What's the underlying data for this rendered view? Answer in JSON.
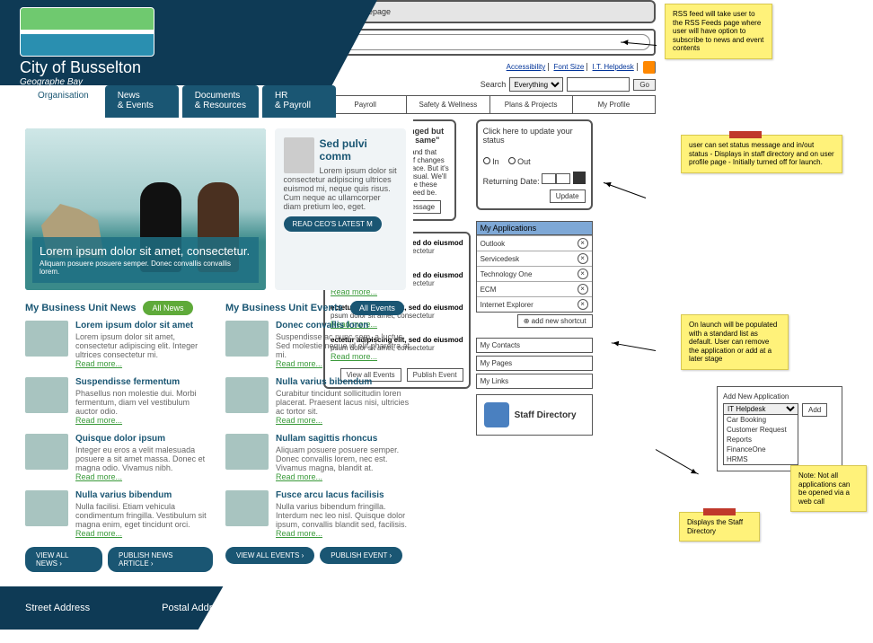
{
  "brand": {
    "title": "City of Busselton",
    "subtitle": "Geographe Bay"
  },
  "nav": {
    "tabs": [
      {
        "line1": "Organisation",
        "line2": ""
      },
      {
        "line1": "News",
        "line2": "& Events"
      },
      {
        "line1": "Documents",
        "line2": "& Resources"
      },
      {
        "line1": "HR",
        "line2": "& Payroll"
      }
    ]
  },
  "hero": {
    "title": "Lorem ipsum dolor sit amet, consectetur.",
    "sub": "Aliquam posuere posuere semper. Donec convallis convallis lorem."
  },
  "ceo": {
    "title": "Sed pulvi comm",
    "body": "Lorem ipsum dolor sit consectetur adipiscing ultrices euismod mi, neque quis risus. Cum neque ac ullamcorper diam pretium leo, eget.",
    "btn": "READ CEO'S LATEST M"
  },
  "news": {
    "heading": "My Business Unit News",
    "pill": "All News",
    "items": [
      {
        "t": "Lorem ipsum dolor sit amet",
        "b": "Lorem ipsum dolor sit amet, consectetur adipiscing elit. Integer ultrices consectetur mi.",
        "r": "Read more..."
      },
      {
        "t": "Suspendisse fermentum",
        "b": "Phasellus non molestie dui. Morbi fermentum, diam vel vestibulum auctor odio.",
        "r": "Read more..."
      },
      {
        "t": "Quisque dolor ipsum",
        "b": "Integer eu eros a velit malesuada posuere a sit amet massa. Donec et magna odio. Vivamus nibh.",
        "r": "Read more..."
      },
      {
        "t": "Nulla varius bibendum",
        "b": "Nulla facilisi. Etiam vehicula condimentum fringilla. Vestibulum sit magna enim, eget tincidunt orci.",
        "r": "Read more..."
      }
    ],
    "cta1": "VIEW ALL NEWS",
    "cta2": "PUBLISH NEWS ARTICLE"
  },
  "events": {
    "heading": "My Business Unit Events",
    "pill": "All Events",
    "items": [
      {
        "t": "Donec convallis loren",
        "b": "Suspendisse ac nunc sem, a luctus. Sed molestie neque id elit pharetra at mi.",
        "r": "Read more..."
      },
      {
        "t": "Nulla varius bibendum",
        "b": "Curabitur tincidunt sollicitudin loren placerat. Praesent lacus nisi, ultricies ac tortor sit.",
        "r": "Read more..."
      },
      {
        "t": "Nullam sagittis rhoncus",
        "b": "Aliquam posuere posuere semper. Donec convallis lorem, nec est. Vivamus magna, blandit at.",
        "r": "Read more..."
      },
      {
        "t": "Fusce arcu lacus facilisis",
        "b": "Nulla varius bibendum fringilla. Interdum nec leo nisl. Quisque dolor ipsum, convallis blandit sed, facilisis.",
        "r": "Read more..."
      }
    ],
    "cta1": "VIEW ALL EVENTS",
    "cta2": "PUBLISH EVENT"
  },
  "footer": {
    "col1": "Street Address",
    "col2": "Postal Address"
  },
  "wire": {
    "windowTitle": "ranet Homepage",
    "topLinks": {
      "a": "Accessibility",
      "b": "Font Size",
      "c": "I.T. Helpdesk"
    },
    "search": {
      "label": "Search",
      "scope": "Everything",
      "go": "Go"
    },
    "tabs": [
      "Payroll",
      "Safety & Wellness",
      "Plans & Projects",
      "My Profile"
    ],
    "ceo": {
      "quote": "\"The name has changed but the game stays the same\"",
      "body": "We're a city, and that means a lot of changes around the place. But it's business as usual. We'll aim to manage these changes as need be.",
      "btn": "Read CEO's latest message"
    },
    "status": {
      "prompt": "Click here to update your status",
      "in": "In",
      "out": "Out",
      "returning": "Returning Date:",
      "update": "Update"
    },
    "apps": {
      "heading": "My Applications",
      "items": [
        "Outlook",
        "Servicedesk",
        "Technology One",
        "ECM",
        "Internet Explorer"
      ],
      "add": "add new shortcut"
    },
    "sideLinks": [
      "My Contacts",
      "My Pages",
      "My Links"
    ],
    "staffDir": "Staff Directory",
    "feed": {
      "items": [
        {
          "b": "ectetur adipiscing elit, sed do eiusmod",
          "s": "psum dolor sit amet, consectetur"
        },
        {
          "b": "ectetur adipiscing elit, sed do eiusmod",
          "s": "psum dolor sit amet, consectetur"
        },
        {
          "b": "ectetur adipiscing elit, sed do eiusmod",
          "s": "psum dolor sit amet, consectetur"
        },
        {
          "b": "ectetur adipiscing elit, sed do eiusmod",
          "s": "psum dolor sit amet, consectetur"
        }
      ],
      "btn1": "View all Events",
      "btn2": "Publish Event"
    },
    "addApp": {
      "title": "Add New Application",
      "selected": "IT Helpdesk",
      "options": [
        "Car Booking",
        "Customer Request",
        "Reports",
        "FinanceOne",
        "HRMS"
      ],
      "btn": "Add"
    }
  },
  "notes": {
    "rss": "RSS feed will take user to the RSS Feeds page where user will have option to subscribe to news and event contents",
    "status": "user can set status message and in/out status\n- Displays in staff directory and on user profile page\n- Initially turned off for launch.",
    "apps": "On launch will be populated with a standard list as default.\nUser can remove the application or add at a later stage",
    "addapp": "Note: Not all applications can be opened via a web call",
    "staff": "Displays the Staff Directory"
  }
}
